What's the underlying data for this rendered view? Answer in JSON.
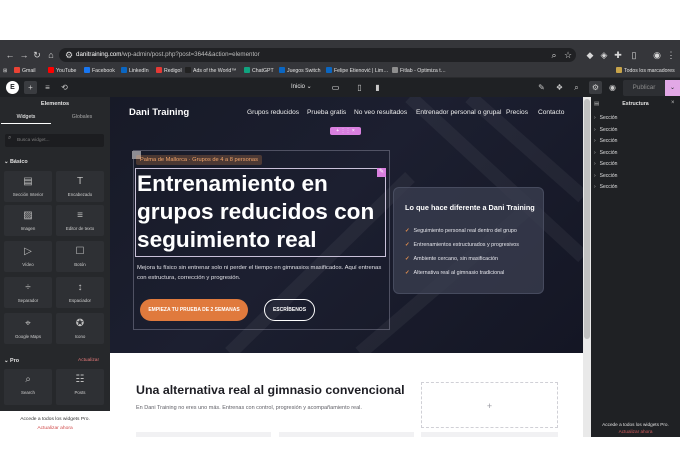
{
  "browser": {
    "url_domain": "danitraining.com",
    "url_path": "/wp-admin/post.php?post=3644&action=elementor",
    "bookmarks": [
      {
        "label": "Gmail",
        "color": "#ea4335"
      },
      {
        "label": "YouTube",
        "color": "#ff0000"
      },
      {
        "label": "Facebook",
        "color": "#1877f2"
      },
      {
        "label": "LinkedIn",
        "color": "#0a66c2"
      },
      {
        "label": "Redigol",
        "color": "#e53935"
      },
      {
        "label": "Ads of the World™",
        "color": "#222222"
      },
      {
        "label": "ChatGPT",
        "color": "#10a37f"
      },
      {
        "label": "Juegos Switch",
        "color": "#0a66c2"
      },
      {
        "label": "Felipe Etienović | Lim…",
        "color": "#0a66c2"
      },
      {
        "label": "Fitlab - Optimiza t…",
        "color": "#8e8e8e"
      }
    ],
    "all_bookmarks": "Todos los marcadores"
  },
  "editor": {
    "page_selector": "Inicio",
    "publish_label": "Publicar"
  },
  "left_panel": {
    "title": "Elementos",
    "tabs": [
      "Widgets",
      "Globales"
    ],
    "search_placeholder": "Busca widget...",
    "basic_section": "Básico",
    "widgets": [
      {
        "label": "Sección Interior",
        "icon": "▤"
      },
      {
        "label": "Encabezado",
        "icon": "T"
      },
      {
        "label": "Imagen",
        "icon": "▨"
      },
      {
        "label": "Editor de texto",
        "icon": "≡"
      },
      {
        "label": "Vídeo",
        "icon": "▷"
      },
      {
        "label": "Botón",
        "icon": "☐"
      },
      {
        "label": "Separador",
        "icon": "÷"
      },
      {
        "label": "Espaciador",
        "icon": "↕"
      },
      {
        "label": "Google Maps",
        "icon": "⌖"
      },
      {
        "label": "Icono",
        "icon": "✪"
      }
    ],
    "pro_section": "Pro",
    "pro_tag": "Actualizar",
    "pro_widgets": [
      {
        "label": "Search",
        "icon": "⌕"
      },
      {
        "label": "Posts",
        "icon": "☷"
      }
    ],
    "footer_text": "Accede a todos los widgets Pro.",
    "footer_link": "Actualizar ahora"
  },
  "site": {
    "brand": "Dani Training",
    "nav": [
      "Grupos reducidos",
      "Prueba gratis",
      "No veo resultados",
      "Entrenador personal o grupal",
      "Precios",
      "Contacto"
    ],
    "hero": {
      "pill": "Palma de Mallorca · Grupos de 4 a 8 personas",
      "heading": "Entrenamiento en grupos reducidos con seguimiento real",
      "lead": "Mejora tu físico sin entrenar solo ni perder el tiempo en gimnasios masificados. Aquí entrenas con estructura, corrección y progresión.",
      "cta_primary": "EMPIEZA TU PRUEBA DE 2 SEMANAS",
      "cta_secondary": "ESCRÍBENOS"
    },
    "card": {
      "title": "Lo que hace diferente a Dani Training",
      "items": [
        "Seguimiento personal real dentro del grupo",
        "Entrenamientos estructurados y progresivos",
        "Ambiente cercano, sin masificación",
        "Alternativa real al gimnasio tradicional"
      ]
    },
    "section2": {
      "title": "Una alternativa real al gimnasio convencional",
      "subtitle": "En Dani Training no eres uno más. Entrenas con control, progresión y acompañamiento real.",
      "placeholder": "+"
    }
  },
  "right_panel": {
    "title": "Estructura",
    "items": [
      "Sección",
      "Sección",
      "Sección",
      "Sección",
      "Sección",
      "Sección",
      "Sección"
    ],
    "footer_text": "Accede a todos los widgets Pro.",
    "footer_link": "Actualizar ahora"
  }
}
